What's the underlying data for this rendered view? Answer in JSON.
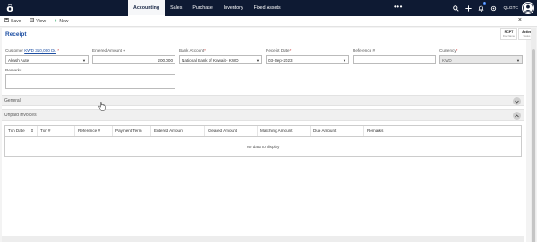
{
  "nav": {
    "logo": "ô",
    "menu": [
      "Accounting",
      "Sales",
      "Purchase",
      "Inventory",
      "Fixed Assets"
    ],
    "more": "•••",
    "notification_count": "1",
    "company": "QLGTC"
  },
  "toolbar": {
    "save": "Save",
    "view": "View",
    "new": "New"
  },
  "form": {
    "title": "Receipt",
    "customer": {
      "label": "Customer",
      "balance_link": "KWD 310,000 Dr.",
      "required": "*",
      "value": "Akash Aute"
    },
    "entered_amount": {
      "label": "Entered Amount",
      "value": "200.000"
    },
    "bank_account": {
      "label": "Bank Account",
      "required": "*",
      "value": "National Bank of Kuwait - KWD"
    },
    "receipt_date": {
      "label": "Receipt Date",
      "required": "*",
      "value": "03-Sep-2023"
    },
    "reference": {
      "label": "Reference #",
      "value": ""
    },
    "currency": {
      "label": "Currency",
      "required": "*",
      "value": "KWD"
    },
    "remarks": {
      "label": "Remarks",
      "value": ""
    }
  },
  "side_tabs": [
    {
      "title": "RCPT",
      "subtitle": "Doc Name"
    },
    {
      "title": "Active",
      "subtitle": "Status"
    }
  ],
  "sections": {
    "general": "General",
    "unpaid_invoices": "Unpaid Invoices"
  },
  "grid": {
    "columns": [
      "Txn Date",
      "Txn #",
      "Reference #",
      "Payment Term",
      "Entered Amount",
      "Cleared Amount",
      "Matching Amount",
      "Due Amount",
      "Remarks"
    ],
    "empty_message": "No data to display"
  }
}
